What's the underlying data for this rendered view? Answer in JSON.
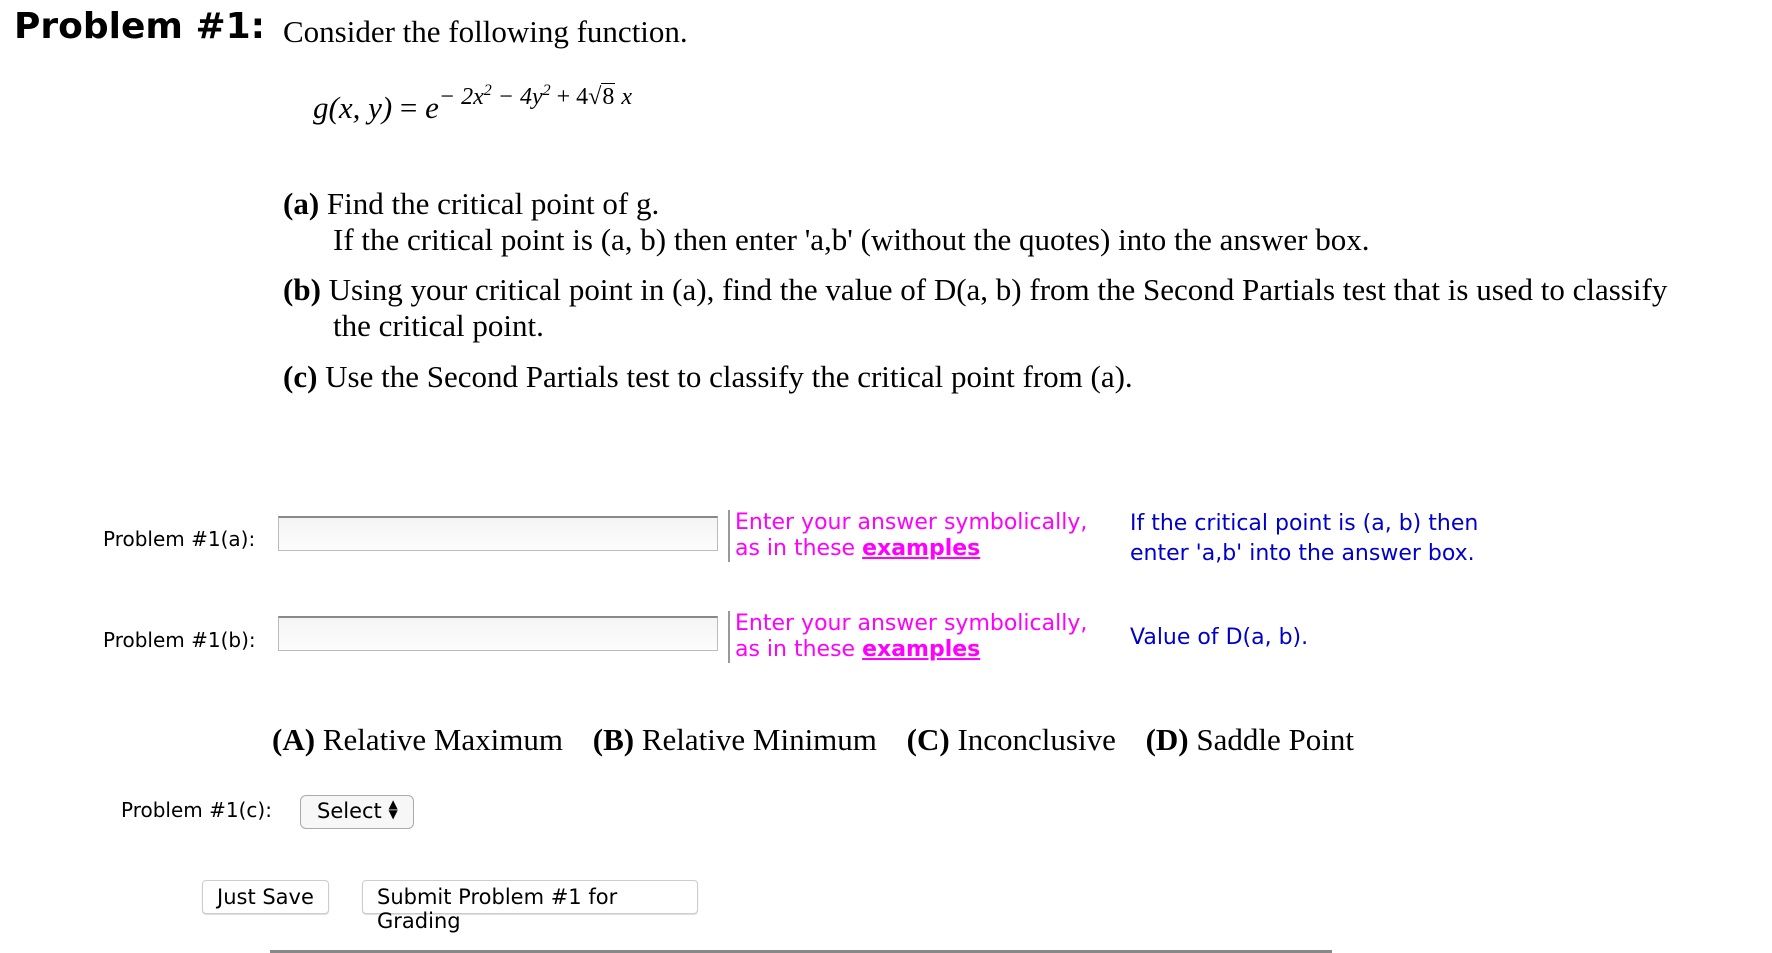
{
  "problem": {
    "heading": "Problem #1:",
    "intro": "Consider the following function.",
    "formula": {
      "lhs": "g(x, y)",
      "equals": "=",
      "base": "e",
      "exponent_parts": [
        "− 2x",
        "2",
        " − 4y",
        "2",
        " + 4",
        "8",
        " x"
      ]
    },
    "parts": {
      "a": {
        "tag": "(a)",
        "line1": "Find the critical point of g.",
        "line2": "If the critical point is (a, b) then enter 'a,b' (without the quotes) into the answer box."
      },
      "b": {
        "tag": "(b)",
        "line1": "Using your critical point in (a), find the value of D(a, b) from the Second Partials test that is used to classify",
        "line2": "the critical point."
      },
      "c": {
        "tag": "(c)",
        "line1": "Use the Second Partials test to classify the critical point from (a)."
      }
    }
  },
  "answers": {
    "a": {
      "label": "Problem #1(a):",
      "value": "",
      "hint_line1": "Enter your answer symbolically,",
      "hint_prefix": "as in these ",
      "hint_link": "examples",
      "note_line1": "If the critical point is (a, b) then",
      "note_line2": "enter 'a,b' into the answer box."
    },
    "b": {
      "label": "Problem #1(b):",
      "value": "",
      "hint_line1": "Enter your answer symbolically,",
      "hint_prefix": "as in these ",
      "hint_link": "examples",
      "note_line1": "Value of D(a, b)."
    },
    "c": {
      "label": "Problem #1(c):",
      "selected": "Select"
    }
  },
  "options": [
    {
      "tag": "(A)",
      "text": " Relative Maximum"
    },
    {
      "tag": "(B)",
      "text": " Relative Minimum"
    },
    {
      "tag": "(C)",
      "text": " Inconclusive"
    },
    {
      "tag": "(D)",
      "text": " Saddle Point"
    }
  ],
  "buttons": {
    "save": "Just Save",
    "submit": "Submit Problem #1 for Grading"
  },
  "colors": {
    "hint": "#ff00ff",
    "note": "#0000cc"
  }
}
